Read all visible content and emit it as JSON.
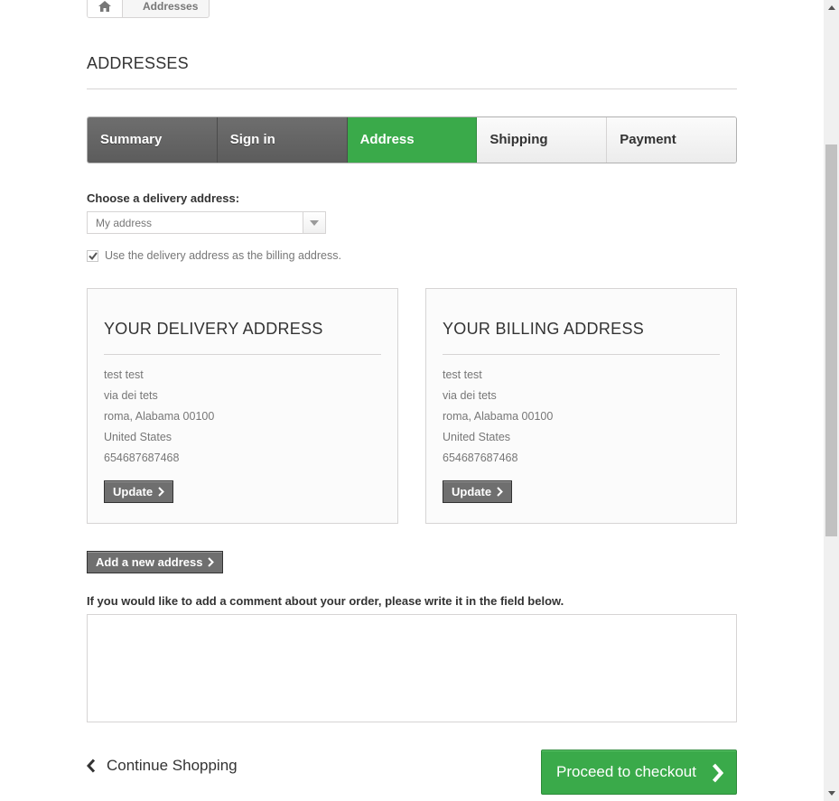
{
  "breadcrumb": {
    "home_icon": "home-icon",
    "current": "Addresses"
  },
  "page_heading": "ADDRESSES",
  "steps": [
    {
      "label": "Summary",
      "state": "done"
    },
    {
      "label": "Sign in",
      "state": "done"
    },
    {
      "label": "Address",
      "state": "current"
    },
    {
      "label": "Shipping",
      "state": "todo"
    },
    {
      "label": "Payment",
      "state": "todo"
    }
  ],
  "delivery_select": {
    "label": "Choose a delivery address:",
    "value": "My address"
  },
  "billing_checkbox": {
    "label": "Use the delivery address as the billing address.",
    "checked": true
  },
  "delivery_address": {
    "title": "YOUR DELIVERY ADDRESS",
    "lines": [
      "test test",
      "via dei tets",
      "roma, Alabama 00100",
      "United States",
      "654687687468"
    ],
    "update_label": "Update"
  },
  "billing_address": {
    "title": "YOUR BILLING ADDRESS",
    "lines": [
      "test test",
      "via dei tets",
      "roma, Alabama 00100",
      "United States",
      "654687687468"
    ],
    "update_label": "Update"
  },
  "add_address_label": "Add a new address",
  "comment": {
    "label": "If you would like to add a comment about your order, please write it in the field below.",
    "value": ""
  },
  "continue_label": "Continue Shopping",
  "proceed_label": "Proceed to checkout",
  "colors": {
    "accent_green": "#3aaa4a",
    "dark_button": "#6f6f6f",
    "border": "#d6d4d4"
  }
}
